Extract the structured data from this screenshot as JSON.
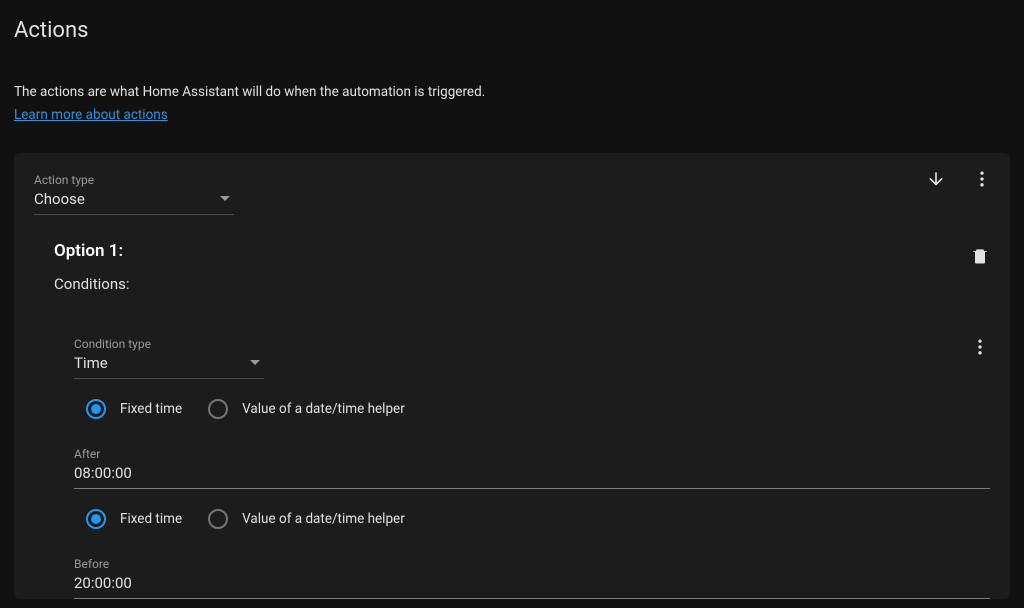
{
  "page": {
    "title": "Actions",
    "description": "The actions are what Home Assistant will do when the automation is triggered.",
    "learn_link": "Learn more about actions"
  },
  "action": {
    "type_label": "Action type",
    "type_value": "Choose"
  },
  "option": {
    "title": "Option 1:",
    "conditions_label": "Conditions:"
  },
  "condition": {
    "type_label": "Condition type",
    "type_value": "Time",
    "radio_fixed": "Fixed time",
    "radio_helper": "Value of a date/time helper",
    "after_label": "After",
    "after_value": "08:00:00",
    "before_label": "Before",
    "before_value": "20:00:00"
  }
}
